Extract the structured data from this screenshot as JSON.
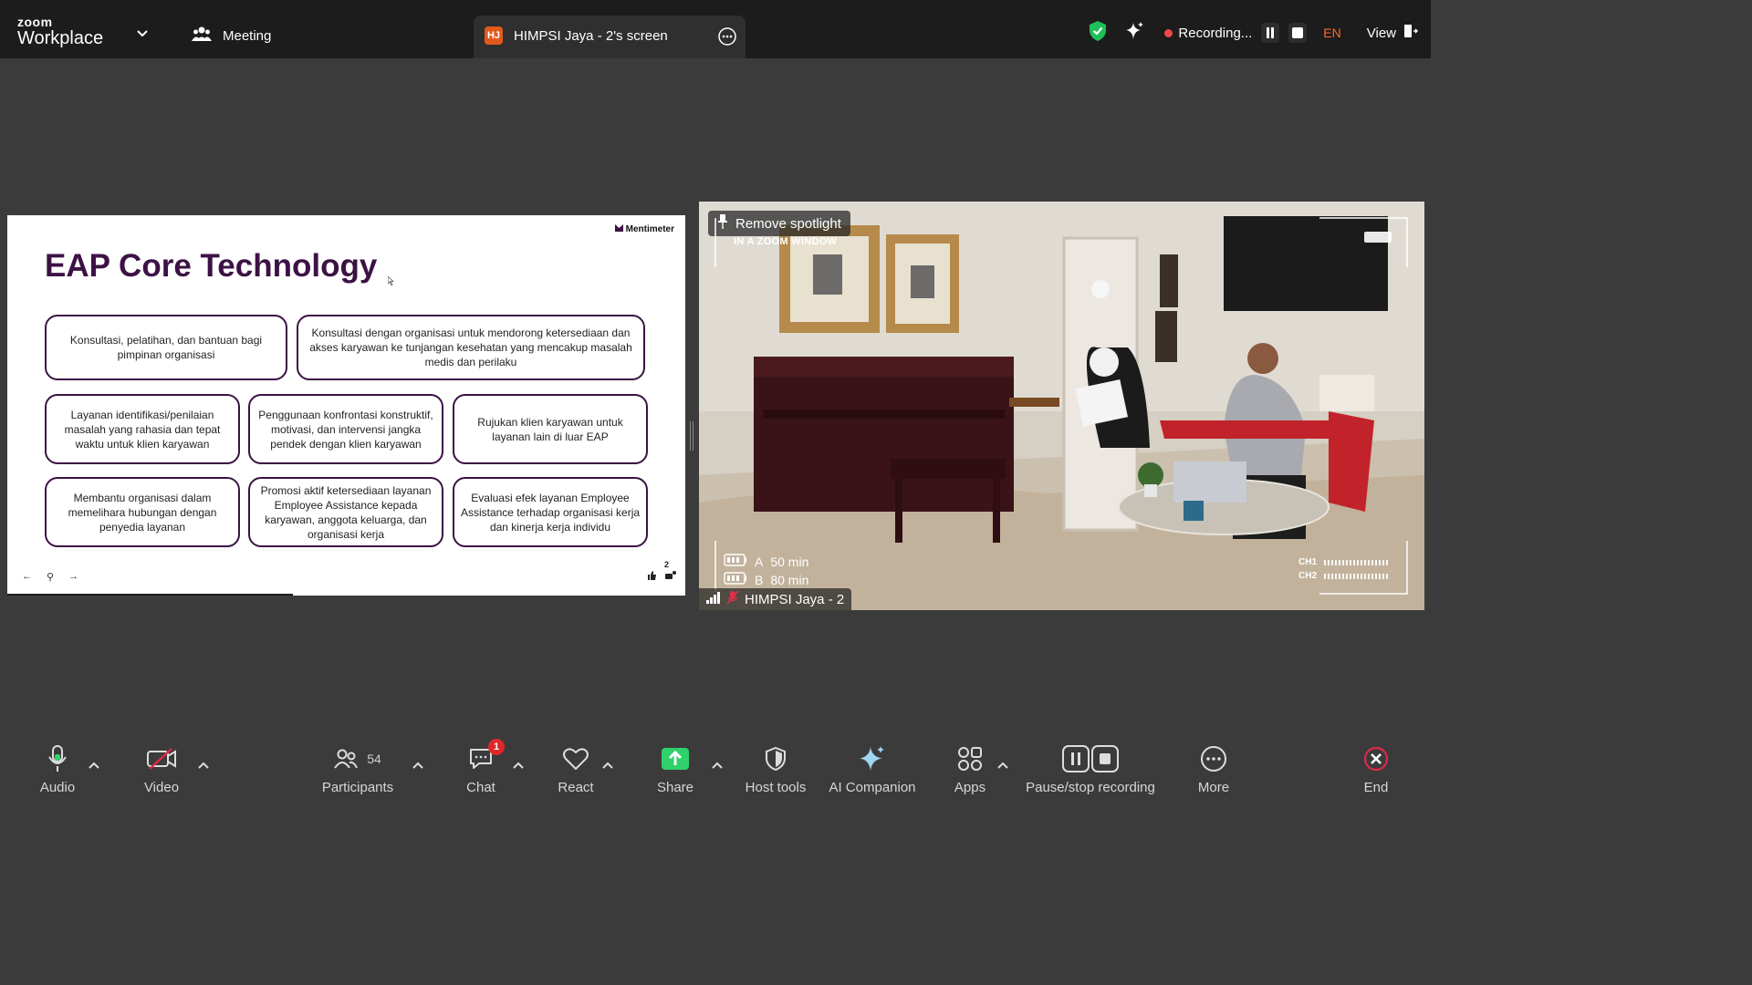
{
  "app": {
    "brand_top": "zoom",
    "brand_bottom": "Workplace",
    "meeting_label": "Meeting"
  },
  "screen_tab": {
    "avatar": "HJ",
    "title": "HIMPSI Jaya - 2's screen"
  },
  "status": {
    "recording_label": "Recording...",
    "language": "EN",
    "view_label": "View"
  },
  "slide": {
    "brand": "Mentimeter",
    "title": "EAP Core Technology",
    "boxes": [
      "Konsultasi, pelatihan, dan bantuan bagi pimpinan organisasi",
      "Konsultasi dengan organisasi untuk mendorong ketersediaan dan akses karyawan ke tunjangan kesehatan yang mencakup masalah medis dan perilaku",
      "Layanan identifikasi/penilaian masalah yang rahasia dan tepat waktu untuk klien karyawan",
      "Penggunaan konfrontasi konstruktif, motivasi, dan intervensi jangka pendek dengan klien karyawan",
      "Rujukan klien karyawan untuk layanan lain di luar EAP",
      "Membantu organisasi dalam memelihara hubungan dengan penyedia layanan",
      "Promosi aktif ketersediaan layanan Employee Assistance kepada karyawan, anggota keluarga, dan organisasi kerja",
      "Evaluasi efek layanan Employee Assistance terhadap organisasi kerja dan kinerja kerja individu"
    ],
    "nav": {
      "prev": "←",
      "pin": "⚲",
      "next": "→"
    },
    "reaction_count": "2"
  },
  "video": {
    "spotlight_label": "Remove spotlight",
    "overlay_text": "IN A ZOOM WINDOW",
    "battery_a": {
      "label": "A",
      "value": "50 min"
    },
    "battery_b": {
      "label": "B",
      "value": "80 min"
    },
    "channels": [
      "CH1",
      "CH2"
    ],
    "participant_name": "HIMPSI Jaya - 2"
  },
  "toolbar": {
    "audio": "Audio",
    "video": "Video",
    "participants": "Participants",
    "participants_count": "54",
    "chat": "Chat",
    "chat_badge": "1",
    "react": "React",
    "share": "Share",
    "host_tools": "Host tools",
    "ai_companion": "AI Companion",
    "apps": "Apps",
    "pause_stop": "Pause/stop recording",
    "more": "More",
    "end": "End"
  },
  "colors": {
    "share_green": "#2fd16a",
    "end_red": "#e02848",
    "slide_purple": "#3c1245",
    "rec_red": "#f04848",
    "shield_green": "#1fbf5a"
  }
}
